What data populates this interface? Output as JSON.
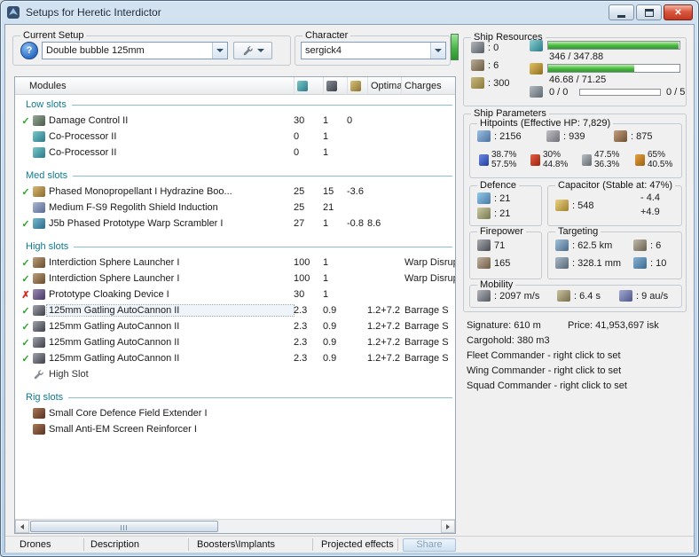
{
  "window": {
    "title": "Setups for Heretic Interdictor",
    "close_glyph": "✕"
  },
  "setup_panel": {
    "current_setup_label": "Current Setup",
    "setup_value": "Double bubble 125mm",
    "help_glyph": "?",
    "character_label": "Character",
    "character_value": "sergick4"
  },
  "table": {
    "header": {
      "modules": "Modules",
      "optimal": "Optimal",
      "charges": "Charges"
    },
    "sections": [
      {
        "title": "Low slots",
        "rows": [
          {
            "mark": "✓",
            "name": "Damage Control II",
            "c1": "30",
            "c2": "1",
            "c3": "0",
            "c4": "",
            "c5": ""
          },
          {
            "mark": "",
            "name": "Co-Processor II",
            "c1": "0",
            "c2": "1",
            "c3": "",
            "c4": "",
            "c5": ""
          },
          {
            "mark": "",
            "name": "Co-Processor II",
            "c1": "0",
            "c2": "1",
            "c3": "",
            "c4": "",
            "c5": ""
          }
        ]
      },
      {
        "title": "Med slots",
        "rows": [
          {
            "mark": "✓",
            "name": "Phased Monopropellant I Hydrazine Boo...",
            "c1": "25",
            "c2": "15",
            "c3": "-3.6",
            "c4": "",
            "c5": ""
          },
          {
            "mark": "",
            "name": "Medium F-S9 Regolith Shield Induction",
            "c1": "25",
            "c2": "21",
            "c3": "",
            "c4": "",
            "c5": ""
          },
          {
            "mark": "✓",
            "name": "J5b Phased Prototype Warp Scrambler I",
            "c1": "27",
            "c2": "1",
            "c3": "-0.8",
            "c4": "8.6",
            "c5": ""
          }
        ]
      },
      {
        "title": "High slots",
        "rows": [
          {
            "mark": "✓",
            "name": "Interdiction Sphere Launcher I",
            "c1": "100",
            "c2": "1",
            "c3": "",
            "c4": "",
            "c5": "Warp Disrupt Probe"
          },
          {
            "mark": "✓",
            "name": "Interdiction Sphere Launcher I",
            "c1": "100",
            "c2": "1",
            "c3": "",
            "c4": "",
            "c5": "Warp Disrupt Probe"
          },
          {
            "mark": "✗",
            "name": "Prototype Cloaking Device I",
            "c1": "30",
            "c2": "1",
            "c3": "",
            "c4": "",
            "c5": ""
          },
          {
            "mark": "✓",
            "name": "125mm Gatling AutoCannon II",
            "c1": "2.3",
            "c2": "0.9",
            "c3": "",
            "c4": "1.2+7.2",
            "c5": "Barrage S"
          },
          {
            "mark": "✓",
            "name": "125mm Gatling AutoCannon II",
            "c1": "2.3",
            "c2": "0.9",
            "c3": "",
            "c4": "1.2+7.2",
            "c5": "Barrage S"
          },
          {
            "mark": "✓",
            "name": "125mm Gatling AutoCannon II",
            "c1": "2.3",
            "c2": "0.9",
            "c3": "",
            "c4": "1.2+7.2",
            "c5": "Barrage S"
          },
          {
            "mark": "✓",
            "name": "125mm Gatling AutoCannon II",
            "c1": "2.3",
            "c2": "0.9",
            "c3": "",
            "c4": "1.2+7.2",
            "c5": "Barrage S"
          },
          {
            "mark": "",
            "name": "High Slot",
            "c1": "",
            "c2": "",
            "c3": "",
            "c4": "",
            "c5": ""
          }
        ]
      },
      {
        "title": "Rig slots",
        "rows": [
          {
            "mark": "",
            "name": "Small Core Defence Field Extender I",
            "c1": "",
            "c2": "",
            "c3": "",
            "c4": "",
            "c5": ""
          },
          {
            "mark": "",
            "name": "Small Anti-EM Screen Reinforcer I",
            "c1": "",
            "c2": "",
            "c3": "",
            "c4": "",
            "c5": ""
          }
        ]
      }
    ]
  },
  "tabs": {
    "drones": "Drones",
    "description": "Description",
    "boosters": "Boosters\\Implants",
    "projected": "Projected effects",
    "share": "Share"
  },
  "resources": {
    "title": "Ship Resources",
    "turrets": ": 0",
    "launchers": ": 6",
    "calibration": ": 300",
    "cpu_text": "346 / 347.88",
    "cpu_pct": 99.5,
    "pg_text": "46.68 / 71.25",
    "pg_pct": 65.5,
    "drones_text": "0 / 0",
    "drone_pct": 0,
    "bandwidth_text": "0 / 5"
  },
  "parameters": {
    "title": "Ship Parameters",
    "hitpoints": {
      "title": "Hitpoints (Effective HP: 7,829)",
      "shield": ": 2156",
      "armor": ": 939",
      "structure": ": 875",
      "resists": [
        {
          "top": "38.7%",
          "bottom": "57.5%"
        },
        {
          "top": "30%",
          "bottom": "44.8%"
        },
        {
          "top": "47.5%",
          "bottom": "36.3%"
        },
        {
          "top": "65%",
          "bottom": "40.5%"
        }
      ]
    },
    "defence": {
      "title": "Defence",
      "shield_recharge": ": 21",
      "armor_repair": ": 21"
    },
    "capacitor": {
      "title": "Capacitor (Stable at: 47%)",
      "amount": ": 548",
      "drain": "- 4.4",
      "recharge": "+4.9"
    },
    "firepower": {
      "title": "Firepower",
      "turret": "71",
      "missile": "165"
    },
    "targeting": {
      "title": "Targeting",
      "range": ": 62.5 km",
      "max_targets": ": 6",
      "scan_resolution": ": 328.1 mm",
      "sensor_strength": ": 10"
    },
    "mobility": {
      "title": "Mobility",
      "speed": ": 2097 m/s",
      "align": ": 6.4 s",
      "warp": ": 9 au/s"
    }
  },
  "info": {
    "signature": "Signature: 610 m",
    "price": "Price: 41,953,697 isk",
    "cargohold": "Cargohold: 380 m3",
    "fleet": "Fleet Commander - right click to set",
    "wing": "Wing Commander - right click to set",
    "squad": "Squad Commander - right click to set"
  }
}
